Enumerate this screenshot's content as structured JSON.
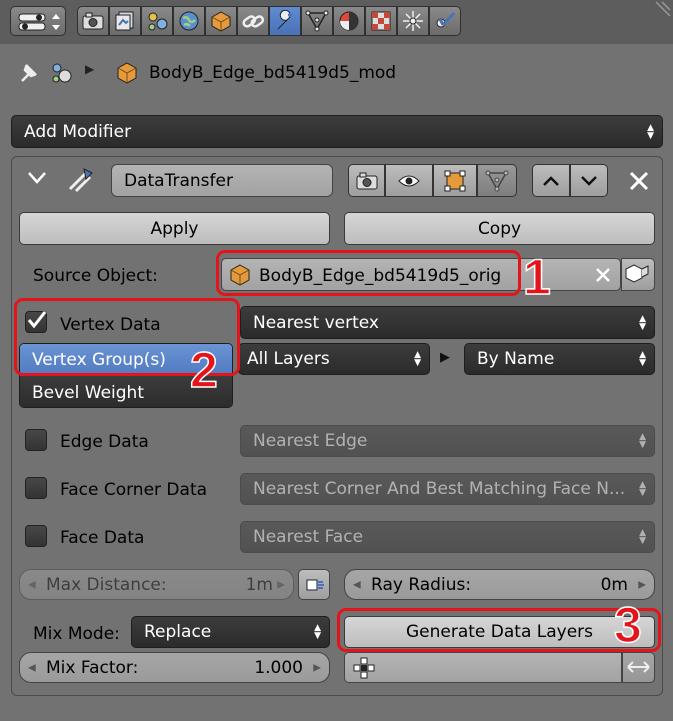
{
  "header": {
    "object_name": "BodyB_Edge_bd5419d5_mod"
  },
  "add_modifier": {
    "label": "Add Modifier"
  },
  "modifier": {
    "name": "DataTransfer",
    "apply_label": "Apply",
    "copy_label": "Copy"
  },
  "source": {
    "label": "Source Object:",
    "value": "BodyB_Edge_bd5419d5_orig"
  },
  "vertex": {
    "label": "Vertex Data",
    "mapping": "Nearest vertex",
    "types": [
      "Vertex Group(s)",
      "Bevel Weight"
    ],
    "layers": "All Layers",
    "match": "By Name"
  },
  "edge": {
    "label": "Edge Data",
    "mapping": "Nearest Edge"
  },
  "face_corner": {
    "label": "Face Corner Data",
    "mapping": "Nearest Corner And Best Matching Face N..."
  },
  "face": {
    "label": "Face Data",
    "mapping": "Nearest Face"
  },
  "max_distance": {
    "label": "Max Distance:",
    "value": "1m"
  },
  "ray_radius": {
    "label": "Ray Radius:",
    "value": "0m"
  },
  "mix_mode": {
    "label": "Mix Mode:",
    "value": "Replace"
  },
  "generate_label": "Generate Data Layers",
  "mix_factor": {
    "label": "Mix Factor:",
    "value": "1.000"
  },
  "annotations": [
    "1",
    "2",
    "3"
  ],
  "colors": {
    "accent_blue": "#5680c2",
    "annotation_red": "#e3141a",
    "panel_gray": "#727272"
  }
}
